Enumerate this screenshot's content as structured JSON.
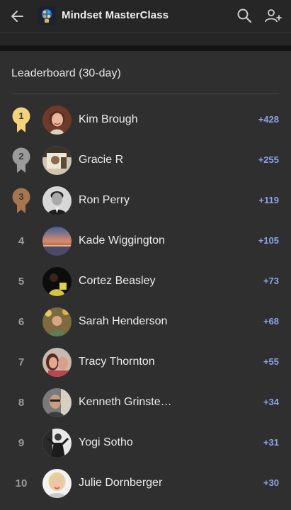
{
  "appbar": {
    "title": "Mindset MasterClass",
    "icons": [
      "back-arrow-icon",
      "app-logo-icon",
      "search-icon",
      "add-person-icon"
    ]
  },
  "leaderboard": {
    "title": "Leaderboard (30-day)",
    "colors": {
      "gold": "#f3d27b",
      "silver": "#9a9a9a",
      "bronze": "#a7764f",
      "points": "#8fa3e8"
    },
    "rows": [
      {
        "rank": "1",
        "name": "Kim Brough",
        "points": "+428"
      },
      {
        "rank": "2",
        "name": "Gracie R",
        "points": "+255"
      },
      {
        "rank": "3",
        "name": "Ron Perry",
        "points": "+119"
      },
      {
        "rank": "4",
        "name": "Kade Wiggington",
        "points": "+105"
      },
      {
        "rank": "5",
        "name": "Cortez Beasley",
        "points": "+73"
      },
      {
        "rank": "6",
        "name": "Sarah Henderson",
        "points": "+68"
      },
      {
        "rank": "7",
        "name": "Tracy Thornton",
        "points": "+55"
      },
      {
        "rank": "8",
        "name": "Kenneth Grinste…",
        "points": "+34"
      },
      {
        "rank": "9",
        "name": "Yogi Sotho",
        "points": "+31"
      },
      {
        "rank": "10",
        "name": "Julie Dornberger",
        "points": "+30"
      }
    ]
  }
}
